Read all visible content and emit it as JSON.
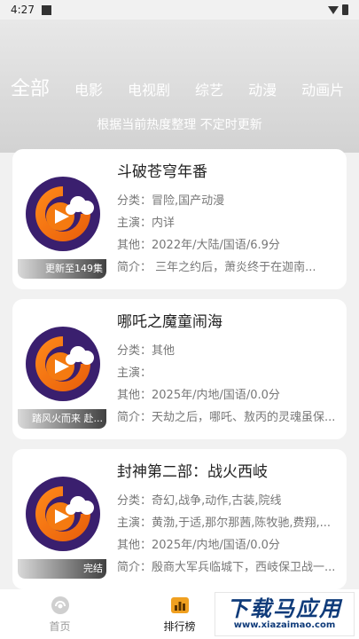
{
  "status_bar": {
    "time": "4:27"
  },
  "tabs": [
    {
      "label": "全部",
      "active": true
    },
    {
      "label": "电影"
    },
    {
      "label": "电视剧"
    },
    {
      "label": "综艺"
    },
    {
      "label": "动漫"
    },
    {
      "label": "动画片"
    }
  ],
  "subtitle": "根据当前热度整理 不定时更新",
  "items": [
    {
      "title": "斗破苍穹年番",
      "badge": "更新至149集",
      "category": "分类：冒险,国产动漫",
      "cast": "主演：内详",
      "other": "其他：2022年/大陆/国语/6.9分",
      "intro": "简介：        三年之约后，萧炎终于在迦南..."
    },
    {
      "title": "哪吒之魔童闹海",
      "badge": "踏风火而来 赴...",
      "category": "分类：其他",
      "cast": "主演：",
      "other": "其他：2025年/内地/国语/0.0分",
      "intro": "简介：天劫之后，哪吒、敖丙的灵魂虽保..."
    },
    {
      "title": "封神第二部：战火西岐",
      "badge": "完结",
      "category": "分类：奇幻,战争,动作,古装,院线",
      "cast": "主演：黄渤,于适,那尔那茜,陈牧驰,费翔,...",
      "other": "其他：2025年/内地/国语/0.0分",
      "intro": "简介：殷商大军兵临城下，西岐保卫战一..."
    }
  ],
  "bottom_nav": [
    {
      "label": "首页",
      "icon": "home-icon"
    },
    {
      "label": "排行榜",
      "icon": "ranking-icon",
      "active": true
    }
  ],
  "watermark": {
    "main": "下载马应用",
    "sub": "www.xiazaimao.com"
  },
  "colors": {
    "logo_orange": "#f47a10",
    "logo_purple": "#3a1f6e",
    "watermark_blue": "#0f3b7a"
  }
}
